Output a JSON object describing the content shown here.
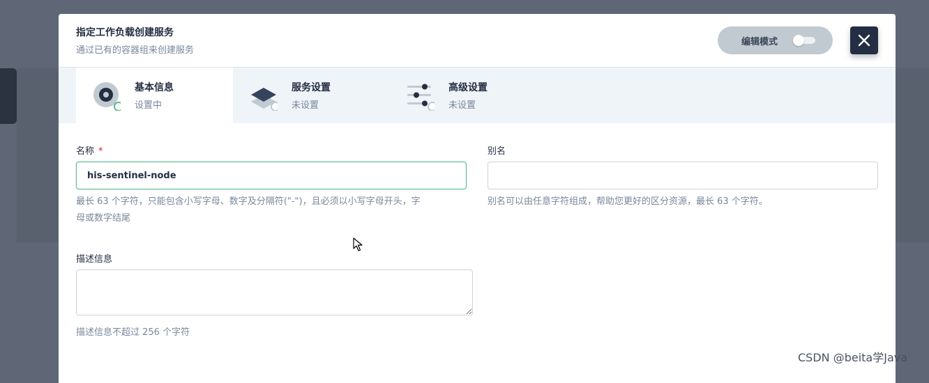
{
  "modal": {
    "title": "指定工作负载创建服务",
    "subtitle": "通过已有的容器组来创建服务",
    "edit_mode_label": "编辑模式",
    "close_icon": "close-icon"
  },
  "steps": [
    {
      "title": "基本信息",
      "status": "设置中",
      "icon": "basic-info-icon"
    },
    {
      "title": "服务设置",
      "status": "未设置",
      "icon": "layers-icon"
    },
    {
      "title": "高级设置",
      "status": "未设置",
      "icon": "sliders-icon"
    }
  ],
  "form": {
    "name": {
      "label": "名称",
      "required_mark": "*",
      "value": "his-sentinel-node",
      "hint": "最长 63 个字符，只能包含小写字母、数字及分隔符(\"-\")，且必须以小写字母开头，字",
      "hint_line2": "母或数字结尾"
    },
    "alias": {
      "label": "别名",
      "value": "",
      "hint": "别名可以由任意字符组成，帮助您更好的区分资源，最长 63 个字符。"
    },
    "description": {
      "label": "描述信息",
      "value": "",
      "hint": "描述信息不超过 256 个字符"
    }
  },
  "colors": {
    "accent_green": "#55bc8a",
    "dark": "#242e42",
    "muted": "#79879c",
    "required": "#ca2621"
  },
  "watermark": "CSDN @beita学Java"
}
